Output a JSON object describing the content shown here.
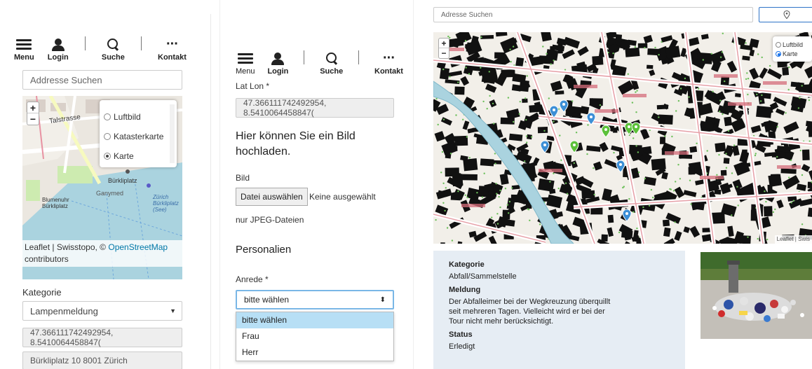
{
  "nav": {
    "menu": "Menu",
    "login": "Login",
    "search": "Suche",
    "contact": "Kontakt"
  },
  "panel1": {
    "address_placeholder": "Addresse Suchen",
    "layers": [
      "Luftbild",
      "Katasterkarte",
      "Karte"
    ],
    "selected_layer": "Karte",
    "map_labels": [
      "Talstrasse",
      "Bürkliplatz",
      "Ganymed",
      "Blumenuhr Bürkliplatz",
      "Zürich Bürkliplatz (See)"
    ],
    "attribution_prefix": "Leaflet | Swisstopo, ©",
    "attribution_link": "OpenStreetMap",
    "attribution_suffix": "contributors",
    "kategorie_label": "Kategorie",
    "kategorie_value": "Lampenmeldung",
    "latlon_value": "47.366111742492954, 8.5410064458847(",
    "address_value": "Bürkliplatz 10 8001 Zürich"
  },
  "panel2": {
    "latlon_label": "Lat Lon *",
    "latlon_value": "47.366111742492954, 8.5410064458847(",
    "upload_heading": "Hier können Sie ein Bild hochladen.",
    "bild_label": "Bild",
    "file_button": "Datei auswählen",
    "file_status": "Keine ausgewählt",
    "file_hint": "nur JPEG-Dateien",
    "personalien_heading": "Personalien",
    "anrede_label": "Anrede *",
    "anrede_selected": "bitte wählen",
    "anrede_options": [
      "bitte wählen",
      "Frau",
      "Herr"
    ]
  },
  "panel3": {
    "address_placeholder": "Adresse Suchen",
    "layers": [
      "Luftbild",
      "Karte"
    ],
    "selected_layer": "Karte",
    "attribution": "Leaflet | Swis",
    "details": {
      "kategorie_label": "Kategorie",
      "kategorie_value": "Abfall/Sammelstelle",
      "meldung_label": "Meldung",
      "meldung_value": "Der Abfalleimer bei der Wegkreuzung überquillt seit mehreren Tagen. Vielleicht wird er bei der Tour nicht mehr berücksichtigt.",
      "status_label": "Status",
      "status_value": "Erledigt"
    }
  },
  "colors": {
    "marker_blue": "#3d8fd6",
    "marker_green": "#5cc13a",
    "info_bg": "#e6edf4",
    "water": "#aad3df"
  }
}
